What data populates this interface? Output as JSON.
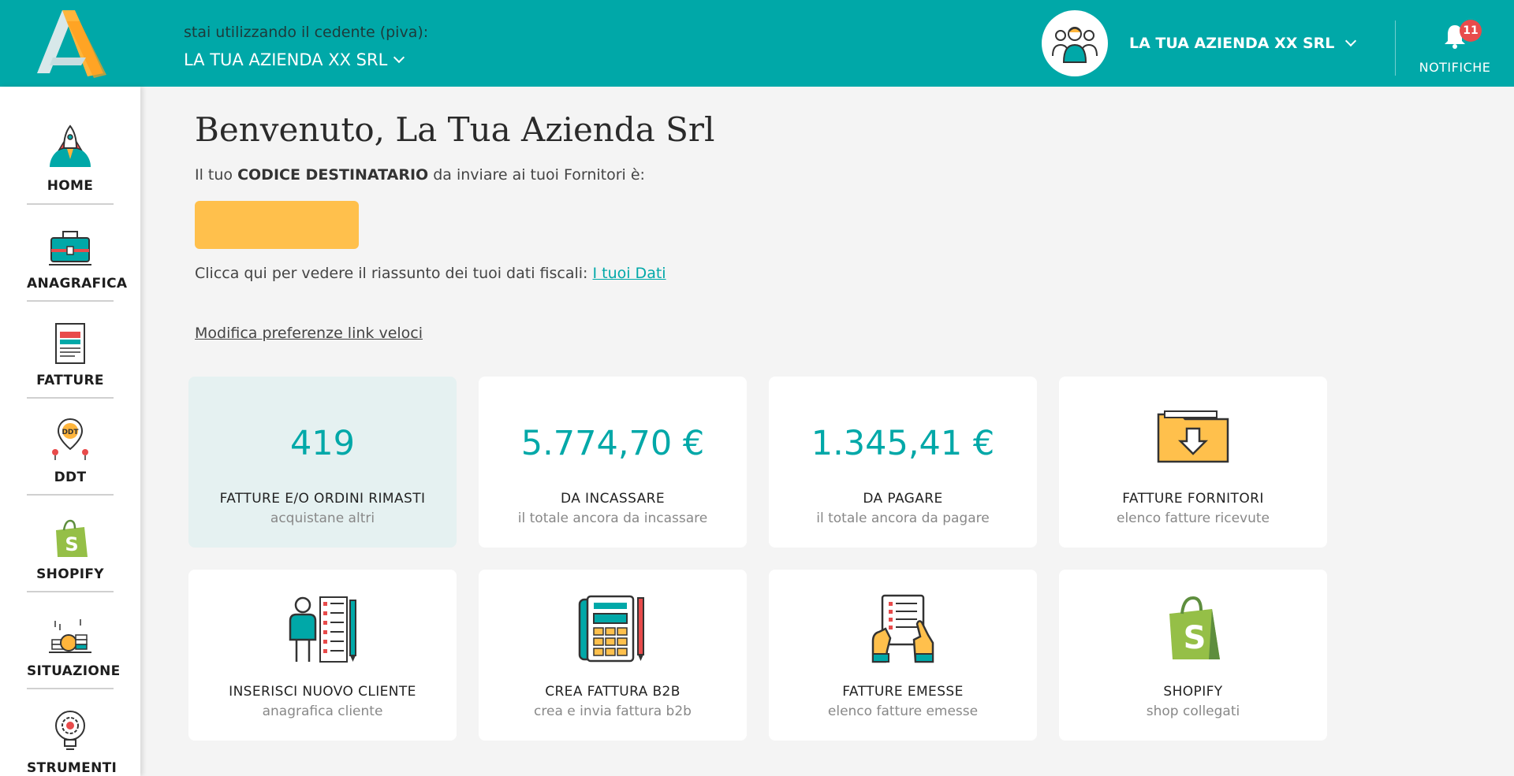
{
  "header": {
    "cedente_label": "stai utilizzando il cedente (piva):",
    "cedente_value": "LA TUA AZIENDA XX SRL",
    "user_name": "LA TUA AZIENDA XX SRL",
    "notifications_label": "NOTIFICHE",
    "notifications_count": "11"
  },
  "sidebar": {
    "items": [
      {
        "label": "HOME",
        "icon": "rocket-icon"
      },
      {
        "label": "ANAGRAFICA",
        "icon": "briefcase-icon"
      },
      {
        "label": "FATTURE",
        "icon": "invoice-icon"
      },
      {
        "label": "DDT",
        "icon": "ddt-pin-icon"
      },
      {
        "label": "SHOPIFY",
        "icon": "shopify-bag-icon"
      },
      {
        "label": "SITUAZIONE",
        "icon": "coins-icon"
      },
      {
        "label": "STRUMENTI",
        "icon": "gear-bulb-icon"
      }
    ]
  },
  "main": {
    "welcome": "Benvenuto, La Tua Azienda Srl",
    "codice_prefix": "Il tuo ",
    "codice_bold": "CODICE DESTINATARIO",
    "codice_suffix": " da inviare ai tuoi Fornitori è:",
    "dati_text": "Clicca qui per vedere il riassunto dei tuoi dati fiscali: ",
    "dati_link": "I tuoi Dati",
    "prefs_link": "Modifica preferenze link veloci"
  },
  "cards": [
    {
      "value": "419",
      "title": "FATTURE E/O ORDINI RIMASTI",
      "sub": "acquistane altri"
    },
    {
      "value": "5.774,70 €",
      "title": "DA INCASSARE",
      "sub": "il totale ancora da incassare"
    },
    {
      "value": "1.345,41 €",
      "title": "DA PAGARE",
      "sub": "il totale ancora da pagare"
    },
    {
      "icon": "folder-download-icon",
      "title": "FATTURE FORNITORI",
      "sub": "elenco fatture ricevute"
    },
    {
      "icon": "new-client-icon",
      "title": "INSERISCI NUOVO CLIENTE",
      "sub": "anagrafica cliente"
    },
    {
      "icon": "calculator-icon",
      "title": "CREA FATTURA B2B",
      "sub": "crea e invia fattura b2b"
    },
    {
      "icon": "issued-invoices-icon",
      "title": "FATTURE EMESSE",
      "sub": "elenco fatture emesse"
    },
    {
      "icon": "shopify-bag-icon",
      "title": "SHOPIFY",
      "sub": "shop collegati"
    }
  ],
  "colors": {
    "accent": "#00a8a8",
    "code_box": "#ffc04c",
    "badge": "#e84b4b",
    "card_highlight": "#e5f1f1"
  }
}
